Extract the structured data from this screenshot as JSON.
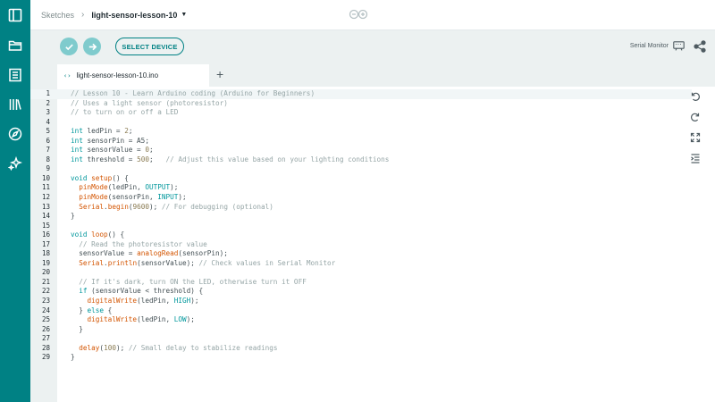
{
  "rail": {
    "items": [
      {
        "name": "sketchbook-toggle",
        "icon": "panel-icon"
      },
      {
        "name": "sketches",
        "icon": "folder-icon"
      },
      {
        "name": "examples",
        "icon": "book-icon"
      },
      {
        "name": "libraries",
        "icon": "library-icon"
      },
      {
        "name": "reference",
        "icon": "compass-icon"
      },
      {
        "name": "ai-assistant",
        "icon": "sparkle-icon"
      }
    ]
  },
  "header": {
    "breadcrumb_root": "Sketches",
    "sketch_name": "light-sensor-lesson-10"
  },
  "toolbar": {
    "select_device_label": "SELECT DEVICE",
    "serial_monitor_label": "Serial Monitor"
  },
  "tabs": {
    "active_tab": "light-sensor-lesson-10.ino",
    "tab_icon": "‹›",
    "add_label": "+"
  },
  "colors": {
    "accent": "#008184",
    "button_light": "#7fcbcd",
    "toolbar_bg": "#ecf1f1"
  },
  "editor": {
    "lines": [
      {
        "n": "1",
        "code": "// Lesson 10 - Learn Arduino coding (Arduino for Beginners)"
      },
      {
        "n": "2",
        "code": "// Uses a light sensor (photoresistor)"
      },
      {
        "n": "3",
        "code": "// to turn on or off a LED"
      },
      {
        "n": "4",
        "code": ""
      },
      {
        "n": "5",
        "code": "int ledPin = 2;"
      },
      {
        "n": "6",
        "code": "int sensorPin = A5;"
      },
      {
        "n": "7",
        "code": "int sensorValue = 0;"
      },
      {
        "n": "8",
        "code": "int threshold = 500;   // Adjust this value based on your lighting conditions"
      },
      {
        "n": "9",
        "code": ""
      },
      {
        "n": "10",
        "code": "void setup() {"
      },
      {
        "n": "11",
        "code": "  pinMode(ledPin, OUTPUT);"
      },
      {
        "n": "12",
        "code": "  pinMode(sensorPin, INPUT);"
      },
      {
        "n": "13",
        "code": "  Serial.begin(9600); // For debugging (optional)"
      },
      {
        "n": "14",
        "code": "}"
      },
      {
        "n": "15",
        "code": ""
      },
      {
        "n": "16",
        "code": "void loop() {"
      },
      {
        "n": "17",
        "code": "  // Read the photoresistor value"
      },
      {
        "n": "18",
        "code": "  sensorValue = analogRead(sensorPin);"
      },
      {
        "n": "19",
        "code": "  Serial.println(sensorValue); // Check values in Serial Monitor"
      },
      {
        "n": "20",
        "code": ""
      },
      {
        "n": "21",
        "code": "  // If it's dark, turn ON the LED, otherwise turn it OFF"
      },
      {
        "n": "22",
        "code": "  if (sensorValue < threshold) {"
      },
      {
        "n": "23",
        "code": "    digitalWrite(ledPin, HIGH);"
      },
      {
        "n": "24",
        "code": "  } else {"
      },
      {
        "n": "25",
        "code": "    digitalWrite(ledPin, LOW);"
      },
      {
        "n": "26",
        "code": "  }"
      },
      {
        "n": "27",
        "code": ""
      },
      {
        "n": "28",
        "code": "  delay(100); // Small delay to stabilize readings"
      },
      {
        "n": "29",
        "code": "}"
      }
    ]
  }
}
